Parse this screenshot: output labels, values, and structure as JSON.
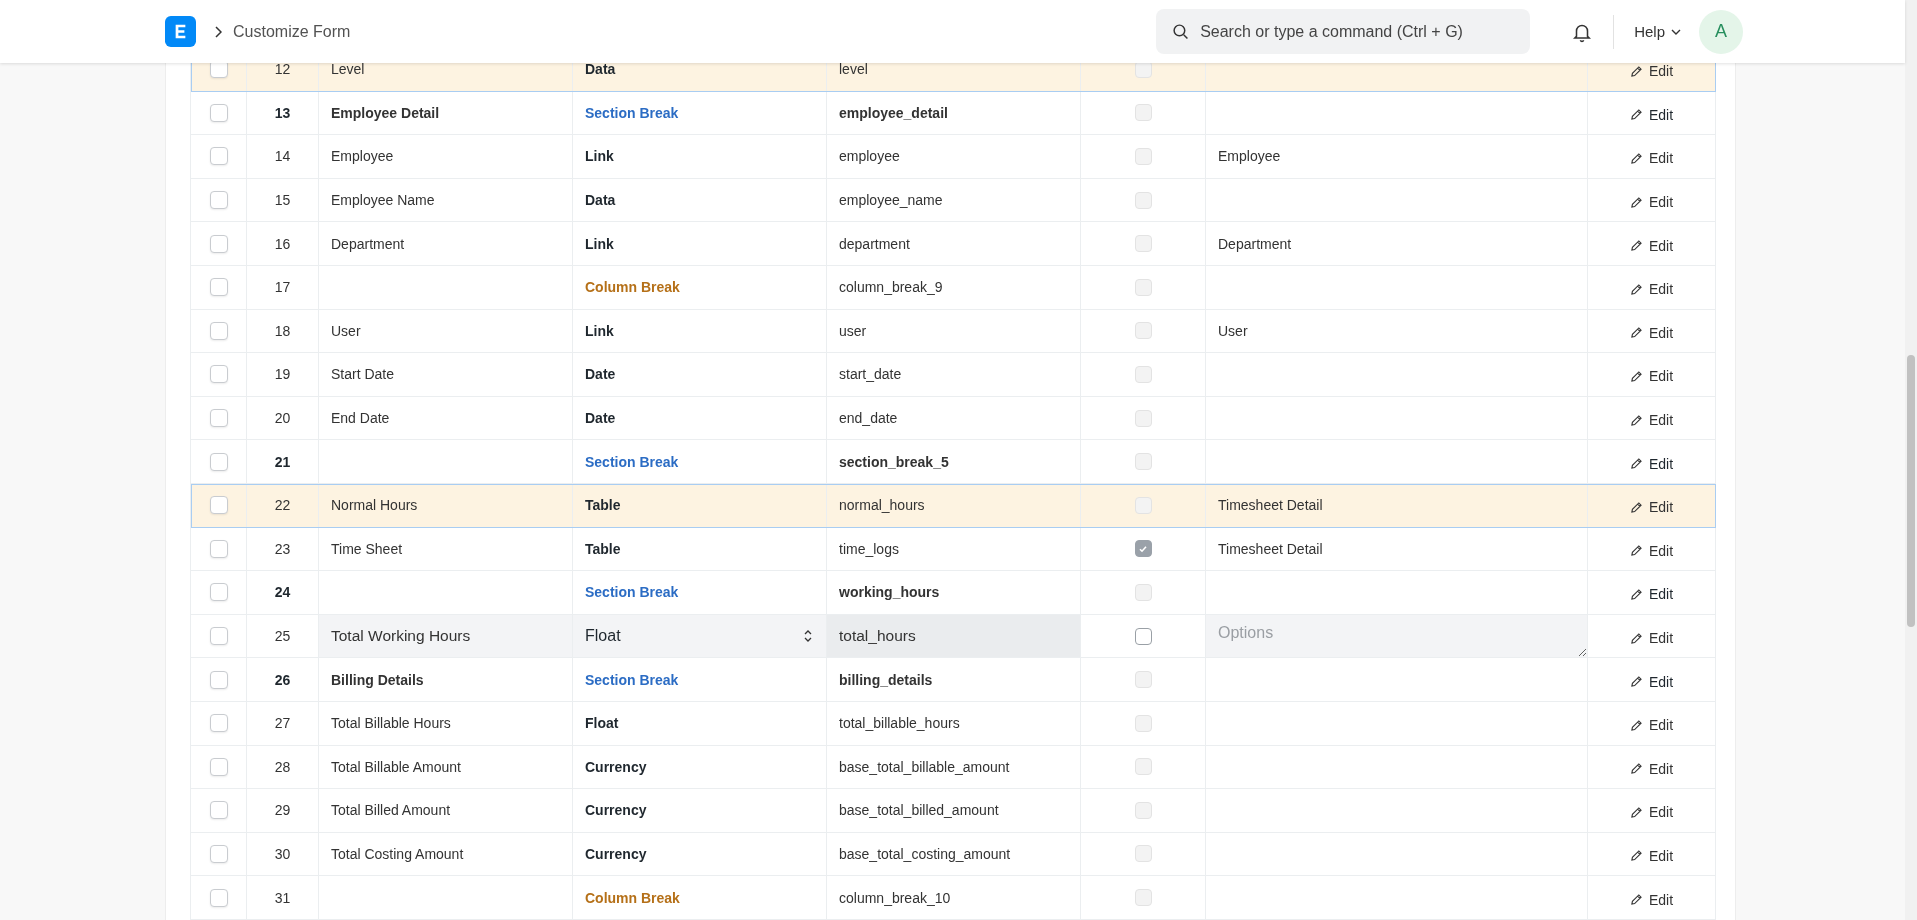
{
  "navbar": {
    "breadcrumb": "Customize Form",
    "search": {
      "placeholder": "Search or type a command (Ctrl + G)"
    },
    "help": "Help",
    "avatar": "A"
  },
  "rows": [
    {
      "kind": "field",
      "idx": "12",
      "label": "Level",
      "fieldtype": "Data",
      "fieldname": "level",
      "hidden": false,
      "highlighted": true,
      "selected": false,
      "action": "Edit"
    },
    {
      "kind": "section_break",
      "idx": "13",
      "label": "Employee Detail",
      "fieldtype": "Section Break",
      "fieldname": "employee_detail",
      "hidden": false,
      "highlighted": false,
      "selected": false,
      "action": "Edit"
    },
    {
      "kind": "field",
      "idx": "14",
      "label": "Employee",
      "fieldtype": "Link",
      "fieldname": "employee",
      "hidden": false,
      "options": "Employee",
      "highlighted": false,
      "selected": false,
      "action": "Edit"
    },
    {
      "kind": "field",
      "idx": "15",
      "label": "Employee Name",
      "fieldtype": "Data",
      "fieldname": "employee_name",
      "hidden": false,
      "highlighted": false,
      "selected": false,
      "action": "Edit"
    },
    {
      "kind": "field",
      "idx": "16",
      "label": "Department",
      "fieldtype": "Link",
      "fieldname": "department",
      "hidden": false,
      "options": "Department",
      "highlighted": false,
      "selected": false,
      "action": "Edit"
    },
    {
      "kind": "column_break",
      "idx": "17",
      "fieldtype": "Column Break",
      "fieldname": "column_break_9",
      "hidden": false,
      "highlighted": false,
      "selected": false,
      "action": "Edit"
    },
    {
      "kind": "field",
      "idx": "18",
      "label": "User",
      "fieldtype": "Link",
      "fieldname": "user",
      "hidden": false,
      "options": "User",
      "highlighted": false,
      "selected": false,
      "action": "Edit"
    },
    {
      "kind": "field",
      "idx": "19",
      "label": "Start Date",
      "fieldtype": "Date",
      "fieldname": "start_date",
      "hidden": false,
      "highlighted": false,
      "selected": false,
      "action": "Edit"
    },
    {
      "kind": "field",
      "idx": "20",
      "label": "End Date",
      "fieldtype": "Date",
      "fieldname": "end_date",
      "hidden": false,
      "highlighted": false,
      "selected": false,
      "action": "Edit"
    },
    {
      "kind": "section_break",
      "idx": "21",
      "fieldtype": "Section Break",
      "fieldname": "section_break_5",
      "hidden": false,
      "highlighted": false,
      "selected": false,
      "action": "Edit"
    },
    {
      "kind": "field",
      "idx": "22",
      "label": "Normal Hours",
      "fieldtype": "Table",
      "fieldname": "normal_hours",
      "hidden": false,
      "options": "Timesheet Detail",
      "highlighted": true,
      "selected": false,
      "action": "Edit"
    },
    {
      "kind": "field",
      "idx": "23",
      "label": "Time Sheet",
      "fieldtype": "Table",
      "fieldname": "time_logs",
      "hidden": true,
      "options": "Timesheet Detail",
      "highlighted": false,
      "selected": false,
      "action": "Edit"
    },
    {
      "kind": "section_break",
      "idx": "24",
      "fieldtype": "Section Break",
      "fieldname": "working_hours",
      "hidden": false,
      "highlighted": false,
      "selected": false,
      "action": "Edit"
    },
    {
      "kind": "editing",
      "idx": "25",
      "label": "Total Working Hours",
      "fieldtype": "Float",
      "fieldname": "total_hours",
      "hidden": false,
      "options_placeholder": "Options",
      "highlighted": false,
      "selected": false,
      "action": "Edit"
    },
    {
      "kind": "section_break",
      "idx": "26",
      "label": "Billing Details",
      "fieldtype": "Section Break",
      "fieldname": "billing_details",
      "hidden": false,
      "highlighted": false,
      "selected": false,
      "action": "Edit"
    },
    {
      "kind": "field",
      "idx": "27",
      "label": "Total Billable Hours",
      "fieldtype": "Float",
      "fieldname": "total_billable_hours",
      "hidden": false,
      "highlighted": false,
      "selected": false,
      "action": "Edit"
    },
    {
      "kind": "field",
      "idx": "28",
      "label": "Total Billable Amount",
      "fieldtype": "Currency",
      "fieldname": "base_total_billable_amount",
      "hidden": false,
      "highlighted": false,
      "selected": false,
      "action": "Edit"
    },
    {
      "kind": "field",
      "idx": "29",
      "label": "Total Billed Amount",
      "fieldtype": "Currency",
      "fieldname": "base_total_billed_amount",
      "hidden": false,
      "highlighted": false,
      "selected": false,
      "action": "Edit"
    },
    {
      "kind": "field",
      "idx": "30",
      "label": "Total Costing Amount",
      "fieldtype": "Currency",
      "fieldname": "base_total_costing_amount",
      "hidden": false,
      "highlighted": false,
      "selected": false,
      "action": "Edit"
    },
    {
      "kind": "column_break",
      "idx": "31",
      "fieldtype": "Column Break",
      "fieldname": "column_break_10",
      "hidden": false,
      "highlighted": false,
      "selected": false,
      "action": "Edit"
    }
  ]
}
